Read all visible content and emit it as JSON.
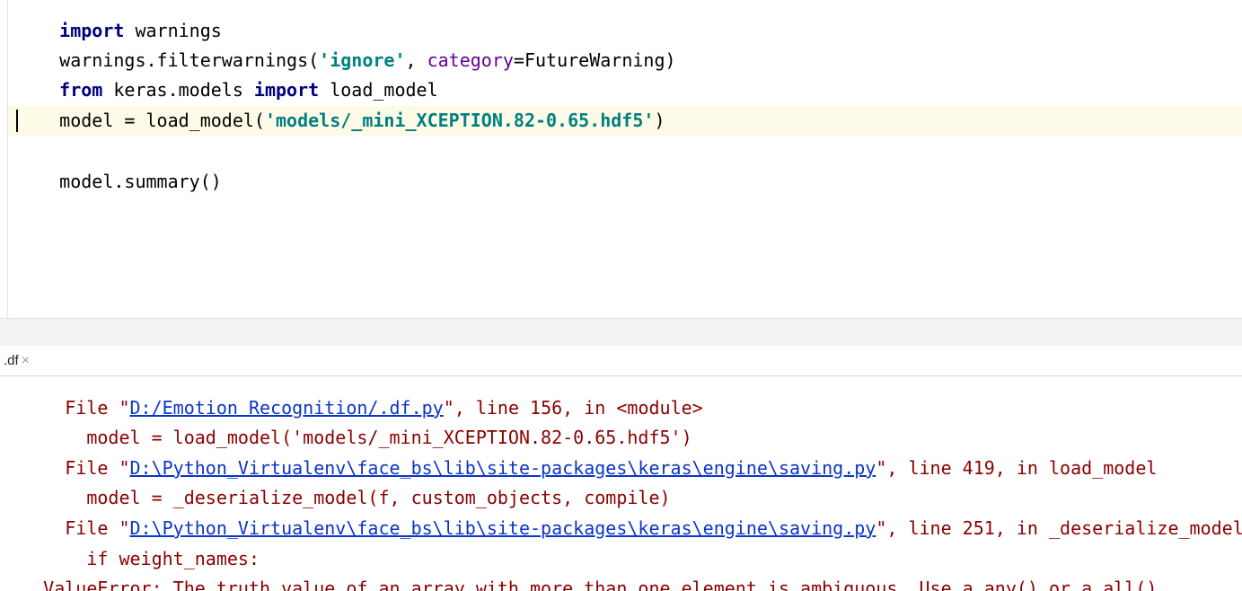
{
  "editor": {
    "line_import": "import warnings",
    "filter": {
      "prefix": "warnings.filterwarnings(",
      "arg_str": "'ignore'",
      "comma": ", ",
      "param_name": "category",
      "rest": "=FutureWarning)"
    },
    "from_line": {
      "kw_from": "from",
      "module": " keras.models ",
      "kw_import": "import",
      "name": " load_model"
    },
    "model_line": {
      "prefix": "model = load_model(",
      "path": "'models/_mini_XCEPTION.82-0.65.hdf5'",
      "suffix": ")"
    },
    "summary_line": "model.summary()"
  },
  "tab": {
    "label": ".df",
    "close": "×"
  },
  "console": {
    "line1": {
      "pre": "  File \"",
      "link": "D:/Emotion Recognition/.df.py",
      "post": "\", line 156, in <module>"
    },
    "line2": "    model = load_model('models/_mini_XCEPTION.82-0.65.hdf5')",
    "line3": {
      "pre": "  File \"",
      "link": "D:\\Python_Virtualenv\\face_bs\\lib\\site-packages\\keras\\engine\\saving.py",
      "post": "\", line 419, in load_model"
    },
    "line4": "    model = _deserialize_model(f, custom_objects, compile)",
    "line5": {
      "pre": "  File \"",
      "link": "D:\\Python_Virtualenv\\face_bs\\lib\\site-packages\\keras\\engine\\saving.py",
      "post": "\", line 251, in _deserialize_model"
    },
    "line6": "    if weight_names:",
    "line7": "ValueError: The truth value of an array with more than one element is ambiguous. Use a.any() or a.all()"
  },
  "colors": {
    "keyword": "#000080",
    "string": "#008080",
    "param": "#660099",
    "error": "#8b0000",
    "link": "#0b35c8",
    "current_line": "#fdfbe7"
  }
}
